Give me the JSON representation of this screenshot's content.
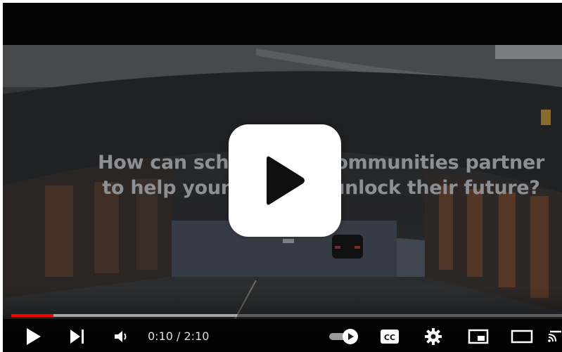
{
  "player": {
    "overlay_text": {
      "line1": "How can schools and communities partner",
      "line2": "to help young people unlock their future?"
    },
    "time": {
      "current": "0:10",
      "separator": " / ",
      "duration": "2:10"
    },
    "progress_played_fraction": 0.077,
    "progress_buffered_fraction": 0.41,
    "cc_label": "CC",
    "colors": {
      "progress_played": "#ff0000",
      "big_play_bg": "#ffffff",
      "icon": "#ffffff"
    },
    "icons": [
      "play-icon",
      "next-icon",
      "volume-icon",
      "autoplay-toggle-icon",
      "cc-icon",
      "settings-gear-icon",
      "miniplayer-icon",
      "theater-mode-icon",
      "cast-icon"
    ]
  }
}
